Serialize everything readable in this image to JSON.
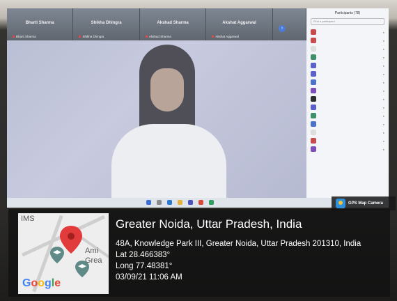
{
  "meeting": {
    "participant_tiles": [
      {
        "name": "Bharti Sharma",
        "sub": "Bharti Sharma"
      },
      {
        "name": "Shikha Dhingra",
        "sub": "Shikha Dhingra"
      },
      {
        "name": "Akshad Sharma",
        "sub": "Akshad Sharma"
      },
      {
        "name": "Akshat Aggarwal",
        "sub": "Akshat Aggarwal"
      }
    ],
    "participants_panel": {
      "title": "Participants (78)",
      "search_placeholder": "Find a participant"
    }
  },
  "gps_camera": {
    "badge": "GPS Map Camera",
    "city": "Greater Noida, Uttar Pradesh, India",
    "address": "48A, Knowledge Park III, Greater Noida, Uttar Pradesh 201310, India",
    "lat": "Lat 28.466383°",
    "long": "Long 77.48381°",
    "datetime": "03/09/21 11:06 AM",
    "map": {
      "label_top": "IMS",
      "label_right1": "Ami",
      "label_right2": "Grea",
      "brand": "Google"
    }
  },
  "colors": {
    "pin": "#e23b3b",
    "map_marker": "#5f8a87",
    "google_blue": "#4285F4",
    "google_red": "#EA4335",
    "google_yellow": "#FBBC05",
    "google_green": "#34A853"
  }
}
